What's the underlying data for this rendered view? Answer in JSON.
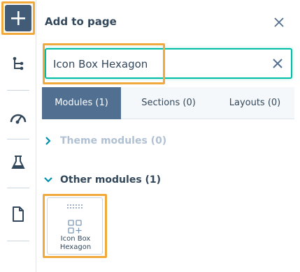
{
  "rail": {
    "items": [
      {
        "name": "add",
        "icon": "plus-icon"
      },
      {
        "name": "layers",
        "icon": "tree-structure-icon"
      },
      {
        "name": "performance",
        "icon": "speedometer-icon"
      },
      {
        "name": "test",
        "icon": "flask-icon"
      },
      {
        "name": "page",
        "icon": "document-icon"
      }
    ],
    "accent": "#425b76"
  },
  "panel": {
    "title": "Add to page",
    "search": {
      "value": "Icon Box Hexagon",
      "placeholder": ""
    },
    "tabs": [
      {
        "label": "Modules (1)",
        "active": true
      },
      {
        "label": "Sections (0)",
        "active": false
      },
      {
        "label": "Layouts (0)",
        "active": false
      }
    ],
    "groups": [
      {
        "label": "Theme modules (0)",
        "expanded": false
      },
      {
        "label": "Other modules (1)",
        "expanded": true
      }
    ],
    "modules": [
      {
        "label": "Icon Box Hexagon",
        "icon": "module-grid-icon"
      }
    ]
  },
  "colors": {
    "highlight": "#f2a93b",
    "teal": "#00bda5",
    "active_tab": "#516f90",
    "text": "#33475b",
    "muted": "#b0c1d4"
  }
}
